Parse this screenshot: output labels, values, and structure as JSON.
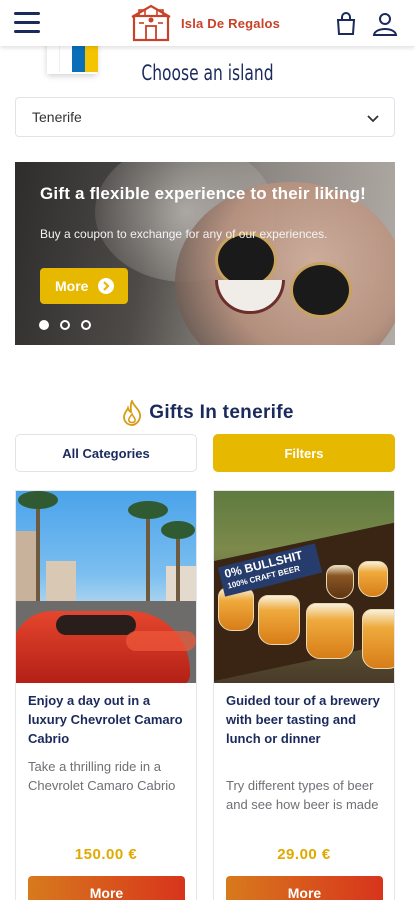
{
  "header": {
    "brand": "Isla De Regalos",
    "icons": [
      "hamburger-menu-icon",
      "shopping-bag-icon",
      "user-icon"
    ]
  },
  "island": {
    "title": "Choose an island",
    "selected": "Tenerife",
    "flag_colors": [
      "#ffffff",
      "#0a6fb8",
      "#f5c400"
    ]
  },
  "hero": {
    "title": "Gift a flexible experience to their liking!",
    "subtitle": "Buy a coupon to exchange for any of our experiences.",
    "button_label": "More",
    "slides": 3,
    "active_slide": 1
  },
  "gifts": {
    "title": "Gifts In tenerife",
    "tabs": {
      "all": "All Categories",
      "filters": "Filters"
    }
  },
  "products": [
    {
      "title": "Enjoy a day out in a luxury Chevrolet Camaro Cabrio",
      "description": "Take a thrilling ride in a Chevrolet Camaro Cabrio",
      "price": "150.00 €",
      "button_label": "More"
    },
    {
      "title": "Guided tour of a brewery with beer tasting and lunch or dinner",
      "description": "Try different types of beer and see how beer is made",
      "price": "29.00 €",
      "button_label": "More",
      "image_sign_line1": "0% BULLSHIT",
      "image_sign_line2": "100% CRAFT BEER"
    }
  ],
  "colors": {
    "navy": "#1b2a5c",
    "accent_yellow": "#e7b800",
    "brand_red": "#c94128",
    "button_gradient": [
      "#d77a1d",
      "#d8341c"
    ]
  }
}
